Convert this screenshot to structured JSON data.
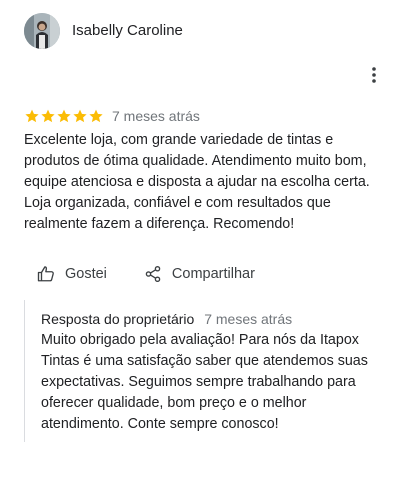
{
  "reviewer": {
    "name": "Isabelly Caroline"
  },
  "review": {
    "rating": 5,
    "rating_max": 5,
    "date": "7 meses atrás",
    "text": "Excelente loja, com grande variedade de tintas e produtos de ótima qualidade. Atendimento muito bom, equipe atenciosa e disposta a ajudar na escolha certa. Loja organizada, confiável e com resultados que realmente fazem a diferença. Recomendo!"
  },
  "actions": {
    "like_label": "Gostei",
    "share_label": "Compartilhar"
  },
  "owner_response": {
    "label": "Resposta do proprietário",
    "date": "7 meses atrás",
    "text": "Muito obrigado pela avaliação! Para nós da Itapox Tintas é uma satisfação saber que atendemos suas expectativas. Seguimos sempre trabalhando para oferecer qualidade, bom preço e o melhor atendimento. Conte sempre conosco!"
  },
  "colors": {
    "star": "#fbbc04",
    "muted_text": "#70757a",
    "text": "#202124",
    "divider": "#dadce0"
  },
  "icons": {
    "more": "more-vert-icon",
    "like": "thumb-up-icon",
    "share": "share-icon",
    "star": "star-icon"
  }
}
